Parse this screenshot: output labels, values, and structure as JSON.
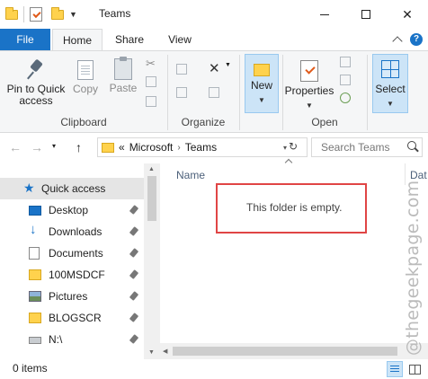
{
  "window": {
    "title": "Teams"
  },
  "ribbon_tabs": {
    "file": "File",
    "home": "Home",
    "share": "Share",
    "view": "View"
  },
  "ribbon": {
    "clipboard": {
      "pin_label": "Pin to Quick access",
      "copy_label": "Copy",
      "paste_label": "Paste",
      "group_label": "Clipboard"
    },
    "organize": {
      "group_label": "Organize"
    },
    "new": {
      "new_label": "New"
    },
    "open": {
      "properties_label": "Properties",
      "group_label": "Open"
    },
    "select": {
      "select_label": "Select"
    }
  },
  "address_bar": {
    "overflow": "«",
    "crumbs": [
      "Microsoft",
      "Teams"
    ],
    "search_placeholder": "Search Teams"
  },
  "nav_pane": {
    "quick_access": "Quick access",
    "items": [
      {
        "label": "Desktop",
        "icon": "desktop-icon",
        "pinned": true
      },
      {
        "label": "Downloads",
        "icon": "download-icon",
        "pinned": true
      },
      {
        "label": "Documents",
        "icon": "documents-icon",
        "pinned": true
      },
      {
        "label": "100MSDCF",
        "icon": "folder-icon",
        "pinned": true
      },
      {
        "label": "Pictures",
        "icon": "pictures-icon",
        "pinned": true
      },
      {
        "label": "BLOGSCR",
        "icon": "folder-icon",
        "pinned": true
      },
      {
        "label": "N:\\",
        "icon": "drive-icon",
        "pinned": true
      }
    ]
  },
  "content": {
    "columns": {
      "name": "Name",
      "date": "Dat"
    },
    "empty_message": "This folder is empty."
  },
  "status_bar": {
    "item_count": "0 items"
  },
  "watermark": "@thegeekpage.com",
  "colors": {
    "accent": "#1a73c7",
    "highlight_box": "#e04545",
    "folder": "#ffd24d"
  }
}
